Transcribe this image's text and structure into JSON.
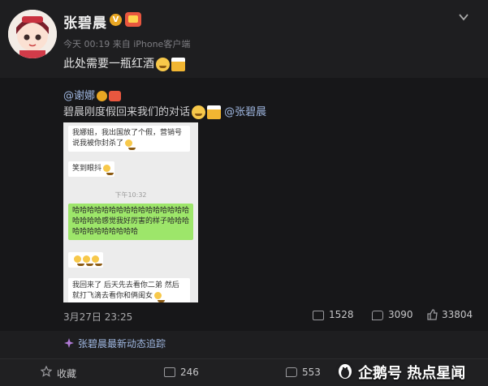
{
  "post": {
    "username": "张碧晨",
    "meta": "今天 00:19 来自 iPhone客户端",
    "text": "此处需要一瓶红酒"
  },
  "repost": {
    "user": "@谢娜",
    "text": "碧晨刚度假回来我们的对话",
    "mention": "@张碧晨",
    "time": "3月27日 23:25",
    "reposts": "1528",
    "comments": "3090",
    "likes": "33804"
  },
  "screenshot": {
    "msg1": "我娜姐，我出国放了个假，营销号说我被你封杀了",
    "msg2": "笑到眼抖",
    "timestamp": "下午10:32",
    "msg3": "哈哈哈哈哈哈哈哈哈哈哈哈哈哈哈哈哈哈哈哈感觉我好厉害的样子哈哈哈哈哈哈哈哈哈哈哈哈",
    "msg5": "我回来了 后天先去看你二弟 然后就打飞滴去看你和俩闺女"
  },
  "follow": "张碧晨最新动态追踪",
  "footer": {
    "collect": "收藏",
    "reposts": "246",
    "comments": "553",
    "watermark": "企鹅号 热点星闻"
  },
  "colors": {
    "link": "#9fb7e0",
    "bg": "#1e1e20",
    "green": "#9de66a"
  }
}
